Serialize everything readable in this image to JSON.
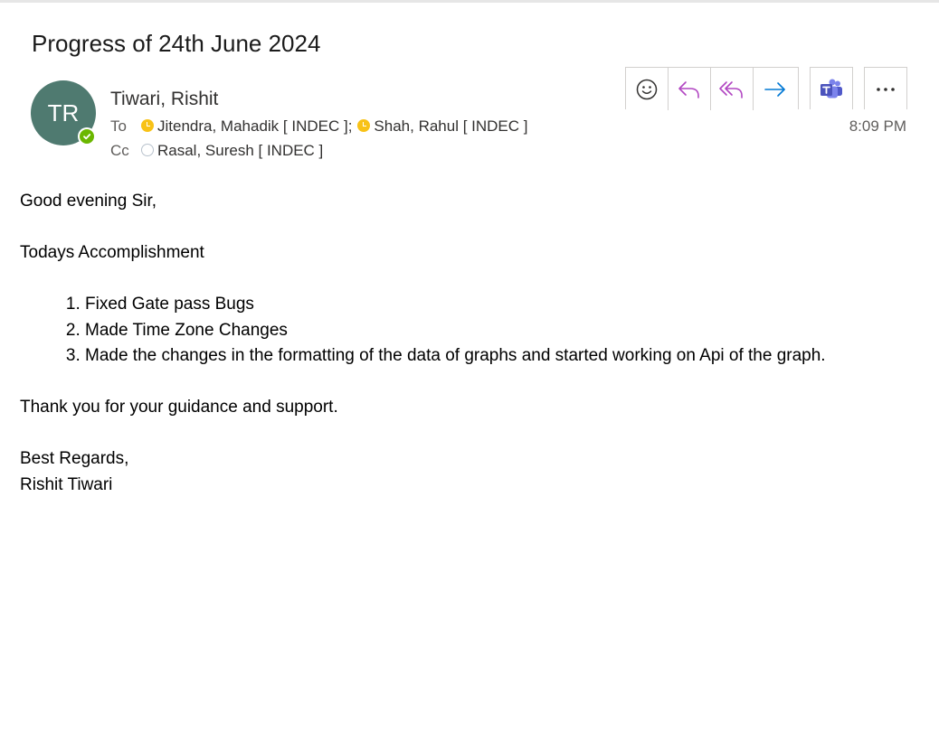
{
  "email": {
    "subject": "Progress of 24th June 2024",
    "avatar_initials": "TR",
    "sender": "Tiwari, Rishit",
    "to_label": "To",
    "cc_label": "Cc",
    "to_recipients": [
      {
        "name": "Jitendra, Mahadik [ INDEC ];",
        "status": "away"
      },
      {
        "name": "Shah, Rahul [ INDEC ]",
        "status": "away"
      }
    ],
    "cc_recipients": [
      {
        "name": "Rasal, Suresh [ INDEC ]",
        "status": "offline"
      }
    ],
    "time": "8:09 PM"
  },
  "toolbar": {
    "buttons": [
      "emoji-icon",
      "reply-icon",
      "reply-all-icon",
      "forward-icon",
      "teams-icon",
      "more-icon"
    ],
    "colors": {
      "reply": "#b146c2",
      "forward": "#0078d4",
      "teams": "#5059c9"
    }
  },
  "body": {
    "greeting": "Good evening Sir,",
    "section_title": "Todays Accomplishment",
    "items": [
      "Fixed Gate pass Bugs",
      "Made Time Zone Changes",
      "Made the changes in the formatting of the data of graphs and started working on Api of the graph."
    ],
    "thanks": "Thank you for your guidance and support.",
    "closing": "Best Regards,",
    "signature": "Rishit Tiwari"
  },
  "colors": {
    "avatar_bg": "#4f7a70",
    "presence_available": "#6bb700",
    "presence_away": "#f8c217"
  }
}
